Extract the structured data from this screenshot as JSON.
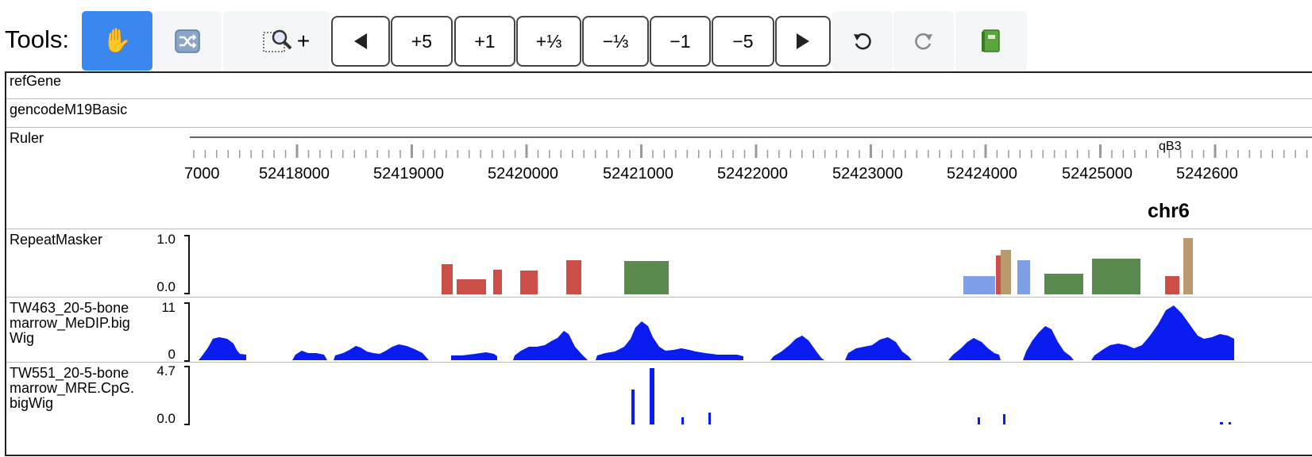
{
  "toolbar": {
    "label": "Tools:",
    "nav_buttons": {
      "plus5": "+5",
      "plus1": "+1",
      "plus_third": "+⅓",
      "minus_third": "−⅓",
      "minus1": "−1",
      "minus5": "−5"
    },
    "zoom_plus": "+",
    "icons": [
      "hand-icon",
      "shuffle-icon",
      "zoom-region-icon",
      "left-arrow-icon",
      "right-arrow-icon",
      "undo-icon",
      "redo-icon",
      "book-icon"
    ]
  },
  "tracks": {
    "refgene": "refGene",
    "gencode": "gencodeM19Basic",
    "ruler": "Ruler",
    "repeatmasker": "RepeatMasker",
    "tw463_l1": "TW463_20-5-bone",
    "tw463_l2": "marrow_MeDIP.big",
    "tw463_l3": "Wig",
    "tw551_l1": "TW551_20-5-bone",
    "tw551_l2": "marrow_MRE.CpG.",
    "tw551_l3": "bigWig"
  },
  "ruler": {
    "ticks": [
      "7000",
      "52418000",
      "52419000",
      "52420000",
      "52421000",
      "52422000",
      "52423000",
      "52424000",
      "52425000",
      "5242600"
    ],
    "band": "qB3",
    "chromosome": "chr6"
  },
  "scales": {
    "repeat_max": "1.0",
    "repeat_min": "0.0",
    "medip_max": "11",
    "medip_min": "0",
    "mre_max": "4.7",
    "mre_min": "0.0"
  },
  "colors": {
    "active_tool": "#3a87f0",
    "repeat_red": "#cc4e48",
    "repeat_green": "#5a8a4e",
    "repeat_tan": "#b89a6e",
    "repeat_lightblue": "#7f9ee8",
    "signal_blue": "#0a1cf0"
  }
}
